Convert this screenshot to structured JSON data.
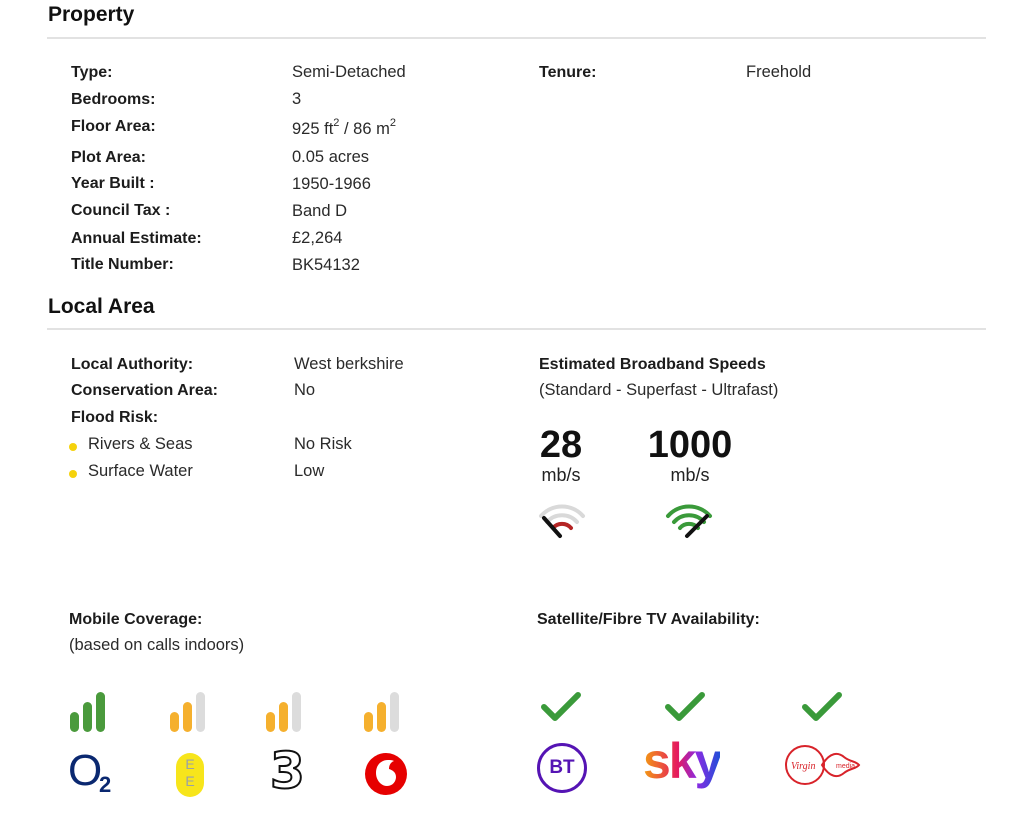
{
  "property": {
    "title": "Property",
    "rows": [
      {
        "label": "Type:",
        "value": "Semi-Detached"
      },
      {
        "label": "Bedrooms:",
        "value": "3"
      },
      {
        "label": "Floor Area:",
        "value_a": "925 ft",
        "sup_a": "2",
        "value_b": " / 86 m",
        "sup_b": "2"
      },
      {
        "label": "Plot Area:",
        "value": "0.05 acres"
      },
      {
        "label": "Year Built :",
        "value": "1950-1966"
      },
      {
        "label": "Council Tax :",
        "value": "Band D"
      },
      {
        "label": "Annual Estimate:",
        "value": "£2,264"
      },
      {
        "label": "Title Number:",
        "value": "BK54132"
      }
    ],
    "tenure": {
      "label": "Tenure:",
      "value": "Freehold"
    }
  },
  "local_area": {
    "title": "Local Area",
    "local_authority": {
      "label": "Local Authority:",
      "value": "West berkshire"
    },
    "conservation": {
      "label": "Conservation Area:",
      "value": "No"
    },
    "flood_risk_label": "Flood Risk:",
    "flood": [
      {
        "label": "Rivers & Seas",
        "value": "No Risk"
      },
      {
        "label": "Surface Water",
        "value": "Low"
      }
    ],
    "flood_dot_color": "#f5d20c"
  },
  "broadband": {
    "title": "Estimated Broadband Speeds",
    "subtitle": "(Standard - Superfast - Ultrafast)",
    "speeds": [
      {
        "value": "28",
        "unit": "mb/s",
        "gauge_level": "low",
        "color": "#b42525",
        "icon": "broadband-low-gauge-icon"
      },
      {
        "value": "1000",
        "unit": "mb/s",
        "gauge_level": "high",
        "color": "#3a9a3a",
        "icon": "broadband-high-gauge-icon"
      }
    ]
  },
  "mobile": {
    "title": "Mobile Coverage:",
    "subtitle": "(based on calls indoors)",
    "providers": [
      {
        "icon": "o2-logo-icon",
        "bars_filled": 3,
        "bar_color": "#4a9a3c",
        "logo_text": "O",
        "logo_sub": "2"
      },
      {
        "icon": "ee-logo-icon",
        "bars_filled": 2,
        "bar_color": "#f5b02e",
        "logo_text": "EE"
      },
      {
        "icon": "three-logo-icon",
        "bars_filled": 2,
        "bar_color": "#f5b02e",
        "logo_text": "3"
      },
      {
        "icon": "vodafone-logo-icon",
        "bars_filled": 2,
        "bar_color": "#f5b02e"
      }
    ],
    "empty_bar_color": "#dcdcdc"
  },
  "tv": {
    "title": "Satellite/Fibre TV Availability:",
    "providers": [
      {
        "icon": "bt-logo-icon",
        "available": true,
        "logo_text": "BT"
      },
      {
        "icon": "sky-logo-icon",
        "available": true,
        "logo_text": "sky"
      },
      {
        "icon": "virgin-media-logo-icon",
        "available": true,
        "logo_text": "Virgin",
        "logo_sub": "media"
      }
    ],
    "check_color": "#3a9a3a"
  }
}
